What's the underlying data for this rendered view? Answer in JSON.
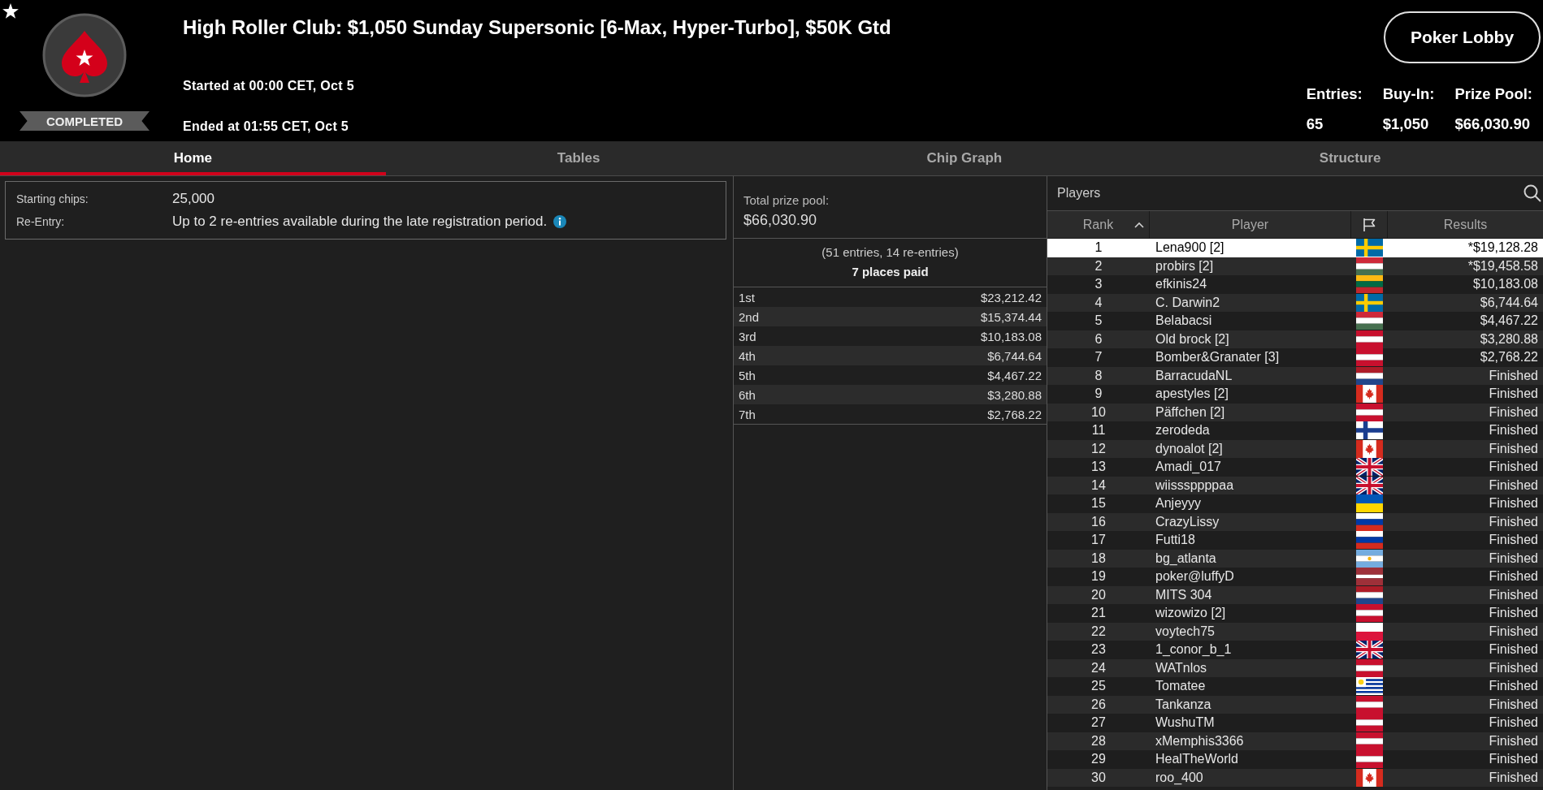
{
  "header": {
    "title": "High Roller Club: $1,050 Sunday Supersonic [6-Max, Hyper-Turbo], $50K Gtd",
    "started": "Started at 00:00 CET, Oct 5",
    "ended": "Ended at 01:55 CET, Oct 5",
    "status": "COMPLETED",
    "lobby_button": "Poker Lobby",
    "stats": [
      {
        "label": "Entries:",
        "value": "65"
      },
      {
        "label": "Buy-In:",
        "value": "$1,050"
      },
      {
        "label": "Prize Pool:",
        "value": "$66,030.90"
      }
    ]
  },
  "tabs": [
    {
      "label": "Home",
      "selected": true
    },
    {
      "label": "Tables",
      "selected": false
    },
    {
      "label": "Chip Graph",
      "selected": false
    },
    {
      "label": "Structure",
      "selected": false
    }
  ],
  "info": {
    "rows": [
      {
        "label": "Starting chips:",
        "value": "25,000",
        "info_icon": false
      },
      {
        "label": "Re-Entry:",
        "value": "Up to 2 re-entries available during the late registration period.",
        "info_icon": true
      }
    ]
  },
  "prize_pool": {
    "title": "Total prize pool:",
    "total": "$66,030.90",
    "entries_note": "(51 entries, 14 re-entries)",
    "places_paid": "7 places paid",
    "payouts": [
      {
        "place": "1st",
        "amount": "$23,212.42"
      },
      {
        "place": "2nd",
        "amount": "$15,374.44"
      },
      {
        "place": "3rd",
        "amount": "$10,183.08"
      },
      {
        "place": "4th",
        "amount": "$6,744.64"
      },
      {
        "place": "5th",
        "amount": "$4,467.22"
      },
      {
        "place": "6th",
        "amount": "$3,280.88"
      },
      {
        "place": "7th",
        "amount": "$2,768.22"
      }
    ]
  },
  "players": {
    "title": "Players",
    "columns": [
      {
        "kind": "text",
        "label": "Rank",
        "sorted": true
      },
      {
        "kind": "text",
        "label": "Player",
        "sorted": false
      },
      {
        "kind": "flag",
        "sorted": false
      },
      {
        "kind": "text",
        "label": "Results",
        "sorted": false
      }
    ],
    "rows": [
      {
        "rank": "1",
        "name": "Lena900 [2]",
        "kind": "sweden",
        "result": "*$19,128.28",
        "selected": true
      },
      {
        "rank": "2",
        "name": "probirs [2]",
        "kind": "hungary",
        "result": "*$19,458.58",
        "selected": false
      },
      {
        "rank": "3",
        "name": "efkinis24",
        "kind": "lithuania",
        "result": "$10,183.08",
        "selected": false
      },
      {
        "rank": "4",
        "name": "C. Darwin2",
        "kind": "sweden",
        "result": "$6,744.64",
        "selected": false
      },
      {
        "rank": "5",
        "name": "Belabacsi",
        "kind": "hungary",
        "result": "$4,467.22",
        "selected": false
      },
      {
        "rank": "6",
        "name": "Old brock [2]",
        "kind": "austria",
        "result": "$3,280.88",
        "selected": false
      },
      {
        "rank": "7",
        "name": "Bomber&Granater [3]",
        "kind": "austria",
        "result": "$2,768.22",
        "selected": false
      },
      {
        "rank": "8",
        "name": "BarracudaNL",
        "kind": "netherlands",
        "result": "Finished",
        "selected": false
      },
      {
        "rank": "9",
        "name": "apestyles [2]",
        "kind": "canada",
        "result": "Finished",
        "selected": false
      },
      {
        "rank": "10",
        "name": "Päffchen [2]",
        "kind": "austria",
        "result": "Finished",
        "selected": false
      },
      {
        "rank": "11",
        "name": "zerodeda",
        "kind": "finland",
        "result": "Finished",
        "selected": false
      },
      {
        "rank": "12",
        "name": "dynoalot [2]",
        "kind": "canada",
        "result": "Finished",
        "selected": false
      },
      {
        "rank": "13",
        "name": "Amadi_017",
        "kind": "uk",
        "result": "Finished",
        "selected": false
      },
      {
        "rank": "14",
        "name": "wiisssppppaa",
        "kind": "uk",
        "result": "Finished",
        "selected": false
      },
      {
        "rank": "15",
        "name": "Anjeyyy",
        "kind": "ukraine",
        "result": "Finished",
        "selected": false
      },
      {
        "rank": "16",
        "name": "CrazyLissy",
        "kind": "russia",
        "result": "Finished",
        "selected": false
      },
      {
        "rank": "17",
        "name": "Futti18",
        "kind": "russia",
        "result": "Finished",
        "selected": false
      },
      {
        "rank": "18",
        "name": "bg_atlanta",
        "kind": "argentina",
        "result": "Finished",
        "selected": false
      },
      {
        "rank": "19",
        "name": "poker@luffyD",
        "kind": "latvia",
        "result": "Finished",
        "selected": false
      },
      {
        "rank": "20",
        "name": "MITS 304",
        "kind": "netherlands",
        "result": "Finished",
        "selected": false
      },
      {
        "rank": "21",
        "name": "wizowizo [2]",
        "kind": "austria",
        "result": "Finished",
        "selected": false
      },
      {
        "rank": "22",
        "name": "voytech75",
        "kind": "poland",
        "result": "Finished",
        "selected": false
      },
      {
        "rank": "23",
        "name": "1_conor_b_1",
        "kind": "uk",
        "result": "Finished",
        "selected": false
      },
      {
        "rank": "24",
        "name": "WATnlos",
        "kind": "austria",
        "result": "Finished",
        "selected": false
      },
      {
        "rank": "25",
        "name": "Tomatee",
        "kind": "uruguay",
        "result": "Finished",
        "selected": false
      },
      {
        "rank": "26",
        "name": "Tankanza",
        "kind": "austria",
        "result": "Finished",
        "selected": false
      },
      {
        "rank": "27",
        "name": "WushuTM",
        "kind": "austria",
        "result": "Finished",
        "selected": false
      },
      {
        "rank": "28",
        "name": "xMemphis3366",
        "kind": "austria",
        "result": "Finished",
        "selected": false
      },
      {
        "rank": "29",
        "name": "HealTheWorld",
        "kind": "austria",
        "result": "Finished",
        "selected": false
      },
      {
        "rank": "30",
        "name": "roo_400",
        "kind": "canada",
        "result": "Finished",
        "selected": false
      }
    ]
  }
}
